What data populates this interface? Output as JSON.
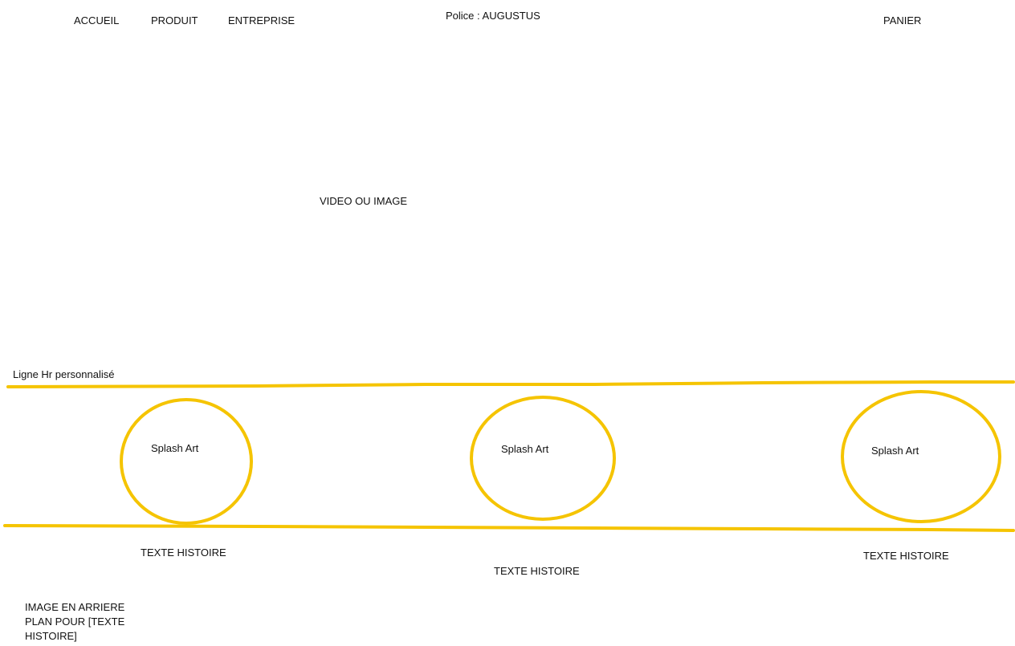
{
  "nav": {
    "items": [
      {
        "label": "ACCUEIL"
      },
      {
        "label": "PRODUIT"
      },
      {
        "label": "ENTREPRISE"
      }
    ],
    "cart_label": "PANIER"
  },
  "font_note": "Police : AUGUSTUS",
  "hero": {
    "label": "VIDEO OU IMAGE"
  },
  "hr_section": {
    "label": "Ligne Hr personnalisé",
    "accent_color": "#f5c400",
    "cards": [
      {
        "splash_label": "Splash Art",
        "story_label": "TEXTE HISTOIRE"
      },
      {
        "splash_label": "Splash Art",
        "story_label": "TEXTE HISTOIRE"
      },
      {
        "splash_label": "Splash Art",
        "story_label": "TEXTE HISTOIRE"
      }
    ]
  },
  "background_note": "IMAGE EN ARRIERE PLAN  POUR [TEXTE HISTOIRE]"
}
